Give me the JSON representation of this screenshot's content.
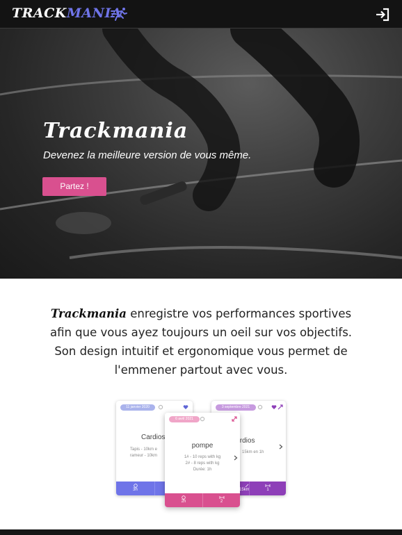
{
  "nav": {
    "brand_part1": "TRACK",
    "brand_part2": "MANIA",
    "icons": [
      "runner-icon",
      "login-icon"
    ]
  },
  "hero": {
    "title": "Trackmania",
    "subtitle": "Devenez la meilleure version de vous même.",
    "cta_label": "Partez !"
  },
  "intro": {
    "brand": "Trackmania",
    "line1_rest": " enregistre vos performances sportives",
    "line2": "afin que vous ayez toujours un oeil sur vos objectifs.",
    "line3": "Son design intuitif et ergonomique vous permet de",
    "line4": "l'emmener partout avec vous."
  },
  "cards": {
    "left": {
      "date": "11 janvier 2020",
      "title": "Cardios",
      "detail1": "Tapis - 10km e",
      "detail2": "rameur - 10km",
      "stat1": "3h"
    },
    "center": {
      "date": "6 avril 2021",
      "title": "pompe",
      "detail1": "1# - 10 reps with kg",
      "detail2": "2# - 8 reps with kg",
      "detail3": "Durée: 1h",
      "stat1": "2h",
      "stat2": "2"
    },
    "right": {
      "date": "3 septembre 2021",
      "title": "Cardios",
      "detail1": "15km en 1h",
      "stat1": "15km",
      "stat2": "1"
    }
  },
  "colors": {
    "accent": "#d9508f",
    "brand_blue": "#6f74e8",
    "purple": "#8e3fb8",
    "nav_bg": "#131313"
  }
}
